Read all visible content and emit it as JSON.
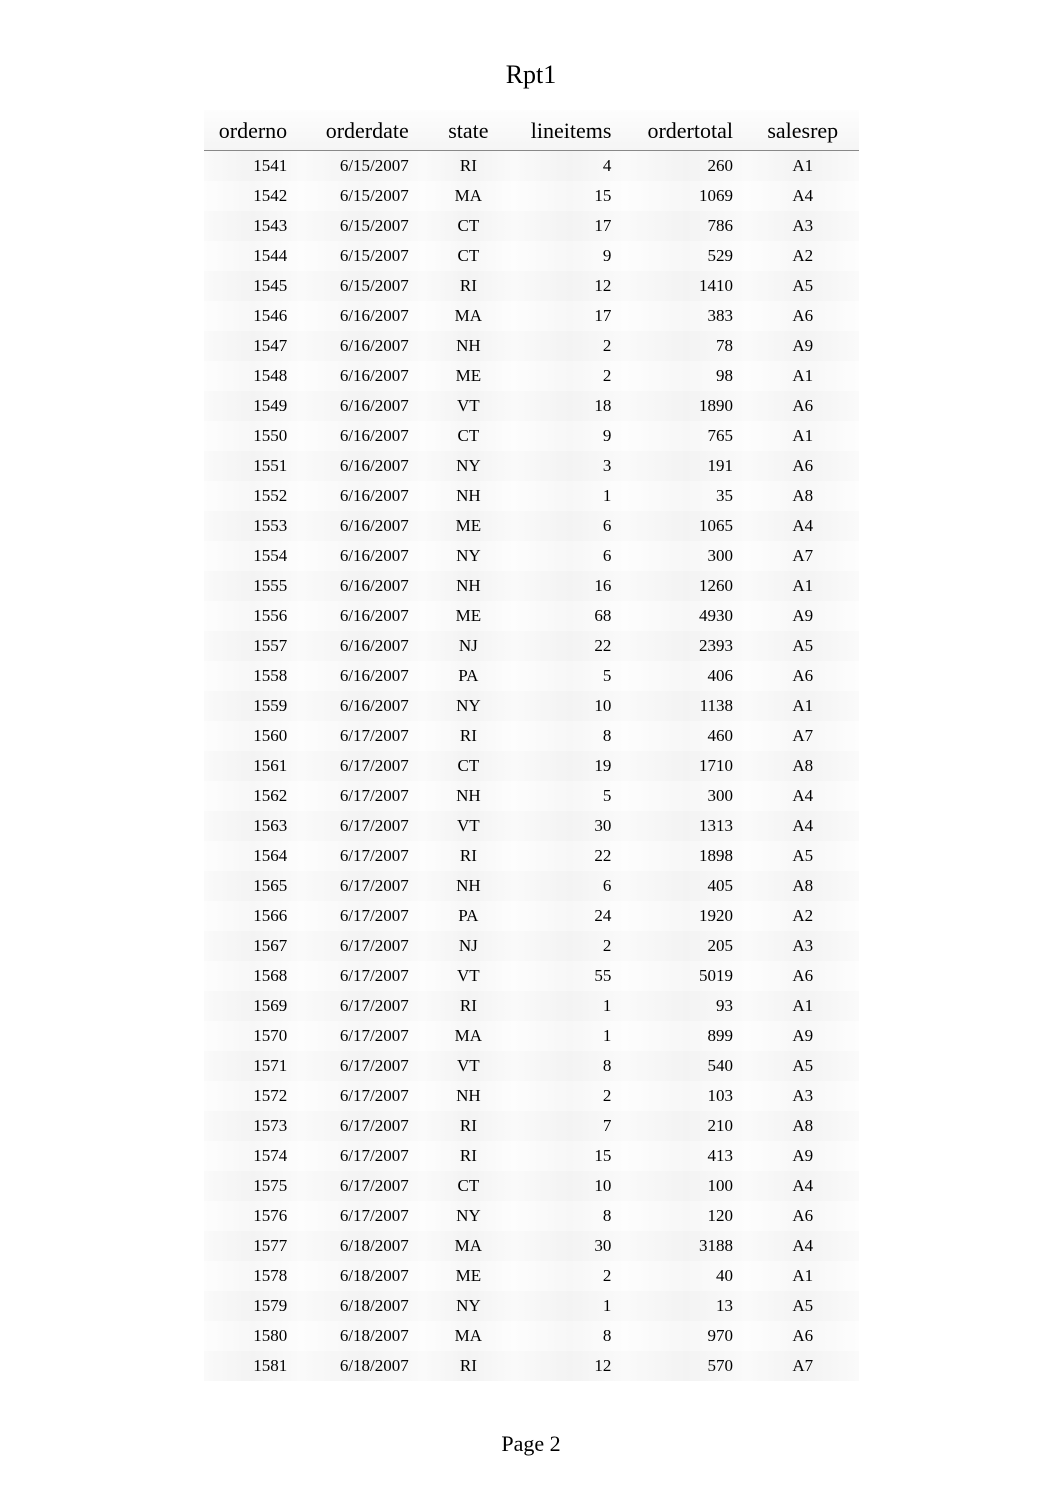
{
  "report": {
    "title": "Rpt1",
    "page_label": "Page 2",
    "columns": {
      "orderno": "orderno",
      "orderdate": "orderdate",
      "state": "state",
      "lineitems": "lineitems",
      "ordertotal": "ordertotal",
      "salesrep": "salesrep"
    },
    "rows": [
      {
        "orderno": "1541",
        "orderdate": "6/15/2007",
        "state": "RI",
        "lineitems": "4",
        "ordertotal": "260",
        "salesrep": "A1"
      },
      {
        "orderno": "1542",
        "orderdate": "6/15/2007",
        "state": "MA",
        "lineitems": "15",
        "ordertotal": "1069",
        "salesrep": "A4"
      },
      {
        "orderno": "1543",
        "orderdate": "6/15/2007",
        "state": "CT",
        "lineitems": "17",
        "ordertotal": "786",
        "salesrep": "A3"
      },
      {
        "orderno": "1544",
        "orderdate": "6/15/2007",
        "state": "CT",
        "lineitems": "9",
        "ordertotal": "529",
        "salesrep": "A2"
      },
      {
        "orderno": "1545",
        "orderdate": "6/15/2007",
        "state": "RI",
        "lineitems": "12",
        "ordertotal": "1410",
        "salesrep": "A5"
      },
      {
        "orderno": "1546",
        "orderdate": "6/16/2007",
        "state": "MA",
        "lineitems": "17",
        "ordertotal": "383",
        "salesrep": "A6"
      },
      {
        "orderno": "1547",
        "orderdate": "6/16/2007",
        "state": "NH",
        "lineitems": "2",
        "ordertotal": "78",
        "salesrep": "A9"
      },
      {
        "orderno": "1548",
        "orderdate": "6/16/2007",
        "state": "ME",
        "lineitems": "2",
        "ordertotal": "98",
        "salesrep": "A1"
      },
      {
        "orderno": "1549",
        "orderdate": "6/16/2007",
        "state": "VT",
        "lineitems": "18",
        "ordertotal": "1890",
        "salesrep": "A6"
      },
      {
        "orderno": "1550",
        "orderdate": "6/16/2007",
        "state": "CT",
        "lineitems": "9",
        "ordertotal": "765",
        "salesrep": "A1"
      },
      {
        "orderno": "1551",
        "orderdate": "6/16/2007",
        "state": "NY",
        "lineitems": "3",
        "ordertotal": "191",
        "salesrep": "A6"
      },
      {
        "orderno": "1552",
        "orderdate": "6/16/2007",
        "state": "NH",
        "lineitems": "1",
        "ordertotal": "35",
        "salesrep": "A8"
      },
      {
        "orderno": "1553",
        "orderdate": "6/16/2007",
        "state": "ME",
        "lineitems": "6",
        "ordertotal": "1065",
        "salesrep": "A4"
      },
      {
        "orderno": "1554",
        "orderdate": "6/16/2007",
        "state": "NY",
        "lineitems": "6",
        "ordertotal": "300",
        "salesrep": "A7"
      },
      {
        "orderno": "1555",
        "orderdate": "6/16/2007",
        "state": "NH",
        "lineitems": "16",
        "ordertotal": "1260",
        "salesrep": "A1"
      },
      {
        "orderno": "1556",
        "orderdate": "6/16/2007",
        "state": "ME",
        "lineitems": "68",
        "ordertotal": "4930",
        "salesrep": "A9"
      },
      {
        "orderno": "1557",
        "orderdate": "6/16/2007",
        "state": "NJ",
        "lineitems": "22",
        "ordertotal": "2393",
        "salesrep": "A5"
      },
      {
        "orderno": "1558",
        "orderdate": "6/16/2007",
        "state": "PA",
        "lineitems": "5",
        "ordertotal": "406",
        "salesrep": "A6"
      },
      {
        "orderno": "1559",
        "orderdate": "6/16/2007",
        "state": "NY",
        "lineitems": "10",
        "ordertotal": "1138",
        "salesrep": "A1"
      },
      {
        "orderno": "1560",
        "orderdate": "6/17/2007",
        "state": "RI",
        "lineitems": "8",
        "ordertotal": "460",
        "salesrep": "A7"
      },
      {
        "orderno": "1561",
        "orderdate": "6/17/2007",
        "state": "CT",
        "lineitems": "19",
        "ordertotal": "1710",
        "salesrep": "A8"
      },
      {
        "orderno": "1562",
        "orderdate": "6/17/2007",
        "state": "NH",
        "lineitems": "5",
        "ordertotal": "300",
        "salesrep": "A4"
      },
      {
        "orderno": "1563",
        "orderdate": "6/17/2007",
        "state": "VT",
        "lineitems": "30",
        "ordertotal": "1313",
        "salesrep": "A4"
      },
      {
        "orderno": "1564",
        "orderdate": "6/17/2007",
        "state": "RI",
        "lineitems": "22",
        "ordertotal": "1898",
        "salesrep": "A5"
      },
      {
        "orderno": "1565",
        "orderdate": "6/17/2007",
        "state": "NH",
        "lineitems": "6",
        "ordertotal": "405",
        "salesrep": "A8"
      },
      {
        "orderno": "1566",
        "orderdate": "6/17/2007",
        "state": "PA",
        "lineitems": "24",
        "ordertotal": "1920",
        "salesrep": "A2"
      },
      {
        "orderno": "1567",
        "orderdate": "6/17/2007",
        "state": "NJ",
        "lineitems": "2",
        "ordertotal": "205",
        "salesrep": "A3"
      },
      {
        "orderno": "1568",
        "orderdate": "6/17/2007",
        "state": "VT",
        "lineitems": "55",
        "ordertotal": "5019",
        "salesrep": "A6"
      },
      {
        "orderno": "1569",
        "orderdate": "6/17/2007",
        "state": "RI",
        "lineitems": "1",
        "ordertotal": "93",
        "salesrep": "A1"
      },
      {
        "orderno": "1570",
        "orderdate": "6/17/2007",
        "state": "MA",
        "lineitems": "1",
        "ordertotal": "899",
        "salesrep": "A9"
      },
      {
        "orderno": "1571",
        "orderdate": "6/17/2007",
        "state": "VT",
        "lineitems": "8",
        "ordertotal": "540",
        "salesrep": "A5"
      },
      {
        "orderno": "1572",
        "orderdate": "6/17/2007",
        "state": "NH",
        "lineitems": "2",
        "ordertotal": "103",
        "salesrep": "A3"
      },
      {
        "orderno": "1573",
        "orderdate": "6/17/2007",
        "state": "RI",
        "lineitems": "7",
        "ordertotal": "210",
        "salesrep": "A8"
      },
      {
        "orderno": "1574",
        "orderdate": "6/17/2007",
        "state": "RI",
        "lineitems": "15",
        "ordertotal": "413",
        "salesrep": "A9"
      },
      {
        "orderno": "1575",
        "orderdate": "6/17/2007",
        "state": "CT",
        "lineitems": "10",
        "ordertotal": "100",
        "salesrep": "A4"
      },
      {
        "orderno": "1576",
        "orderdate": "6/17/2007",
        "state": "NY",
        "lineitems": "8",
        "ordertotal": "120",
        "salesrep": "A6"
      },
      {
        "orderno": "1577",
        "orderdate": "6/18/2007",
        "state": "MA",
        "lineitems": "30",
        "ordertotal": "3188",
        "salesrep": "A4"
      },
      {
        "orderno": "1578",
        "orderdate": "6/18/2007",
        "state": "ME",
        "lineitems": "2",
        "ordertotal": "40",
        "salesrep": "A1"
      },
      {
        "orderno": "1579",
        "orderdate": "6/18/2007",
        "state": "NY",
        "lineitems": "1",
        "ordertotal": "13",
        "salesrep": "A5"
      },
      {
        "orderno": "1580",
        "orderdate": "6/18/2007",
        "state": "MA",
        "lineitems": "8",
        "ordertotal": "970",
        "salesrep": "A6"
      },
      {
        "orderno": "1581",
        "orderdate": "6/18/2007",
        "state": "RI",
        "lineitems": "12",
        "ordertotal": "570",
        "salesrep": "A7"
      }
    ]
  }
}
